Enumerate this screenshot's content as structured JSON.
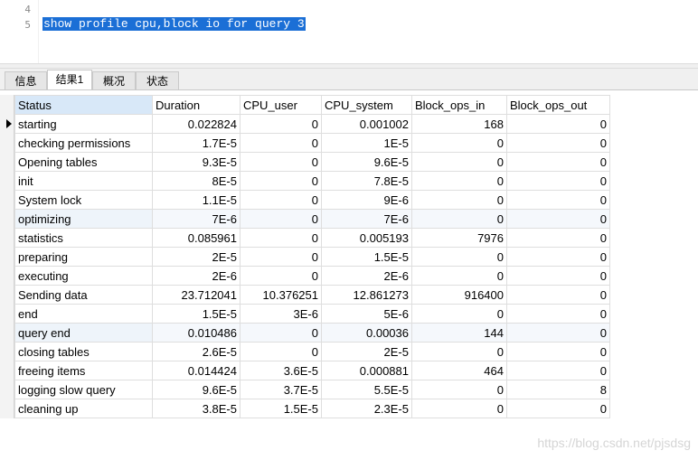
{
  "editor": {
    "lines": [
      {
        "number": "4",
        "text": ""
      },
      {
        "number": "5",
        "text": "show profile cpu,block io for query 3"
      }
    ]
  },
  "tabs": [
    {
      "label": "信息",
      "active": false
    },
    {
      "label": "结果1",
      "active": true
    },
    {
      "label": "概况",
      "active": false
    },
    {
      "label": "状态",
      "active": false
    }
  ],
  "grid": {
    "columns": [
      "Status",
      "Duration",
      "CPU_user",
      "CPU_system",
      "Block_ops_in",
      "Block_ops_out"
    ],
    "rows": [
      [
        "starting",
        "0.022824",
        "0",
        "0.001002",
        "168",
        "0"
      ],
      [
        "checking permissions",
        "1.7E-5",
        "0",
        "1E-5",
        "0",
        "0"
      ],
      [
        "Opening tables",
        "9.3E-5",
        "0",
        "9.6E-5",
        "0",
        "0"
      ],
      [
        "init",
        "8E-5",
        "0",
        "7.8E-5",
        "0",
        "0"
      ],
      [
        "System lock",
        "1.1E-5",
        "0",
        "9E-6",
        "0",
        "0"
      ],
      [
        "optimizing",
        "7E-6",
        "0",
        "7E-6",
        "0",
        "0"
      ],
      [
        "statistics",
        "0.085961",
        "0",
        "0.005193",
        "7976",
        "0"
      ],
      [
        "preparing",
        "2E-5",
        "0",
        "1.5E-5",
        "0",
        "0"
      ],
      [
        "executing",
        "2E-6",
        "0",
        "2E-6",
        "0",
        "0"
      ],
      [
        "Sending data",
        "23.712041",
        "10.376251",
        "12.861273",
        "916400",
        "0"
      ],
      [
        "end",
        "1.5E-5",
        "3E-6",
        "5E-6",
        "0",
        "0"
      ],
      [
        "query end",
        "0.010486",
        "0",
        "0.00036",
        "144",
        "0"
      ],
      [
        "closing tables",
        "2.6E-5",
        "0",
        "2E-5",
        "0",
        "0"
      ],
      [
        "freeing items",
        "0.014424",
        "3.6E-5",
        "0.000881",
        "464",
        "0"
      ],
      [
        "logging slow query",
        "9.6E-5",
        "3.7E-5",
        "5.5E-5",
        "0",
        "8"
      ],
      [
        "cleaning up",
        "3.8E-5",
        "1.5E-5",
        "2.3E-5",
        "0",
        "0"
      ]
    ],
    "current_row_index": 0
  },
  "watermark": "https://blog.csdn.net/pjsdsg",
  "colors": {
    "selection": "#1b6fd6",
    "header_status_bg": "#d8e8f8",
    "alt_row_bg": "#f5f8fc"
  }
}
